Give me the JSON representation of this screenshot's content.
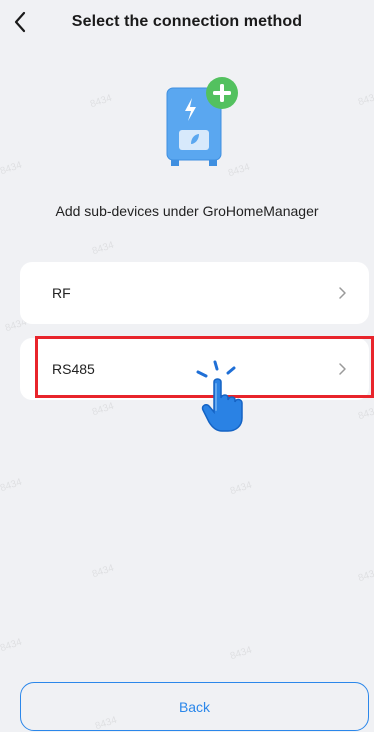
{
  "header": {
    "title": "Select the connection method",
    "back_icon": "chevron-left-icon"
  },
  "hero": {
    "device_icon": "inverter-device-icon",
    "badge_icon": "plus-badge-icon",
    "subtitle": "Add sub-devices under GroHomeManager"
  },
  "methods": [
    {
      "label": "RF",
      "icon": "chevron-right-icon"
    },
    {
      "label": "RS485",
      "icon": "chevron-right-icon"
    }
  ],
  "annotation": {
    "highlight_color": "#e8242b",
    "pointer_icon": "tap-hand-icon"
  },
  "footer": {
    "back_label": "Back"
  },
  "colors": {
    "background": "#f0f1f4",
    "accent": "#2b87ea",
    "device_body": "#5aa7f0",
    "badge": "#53c15f"
  }
}
